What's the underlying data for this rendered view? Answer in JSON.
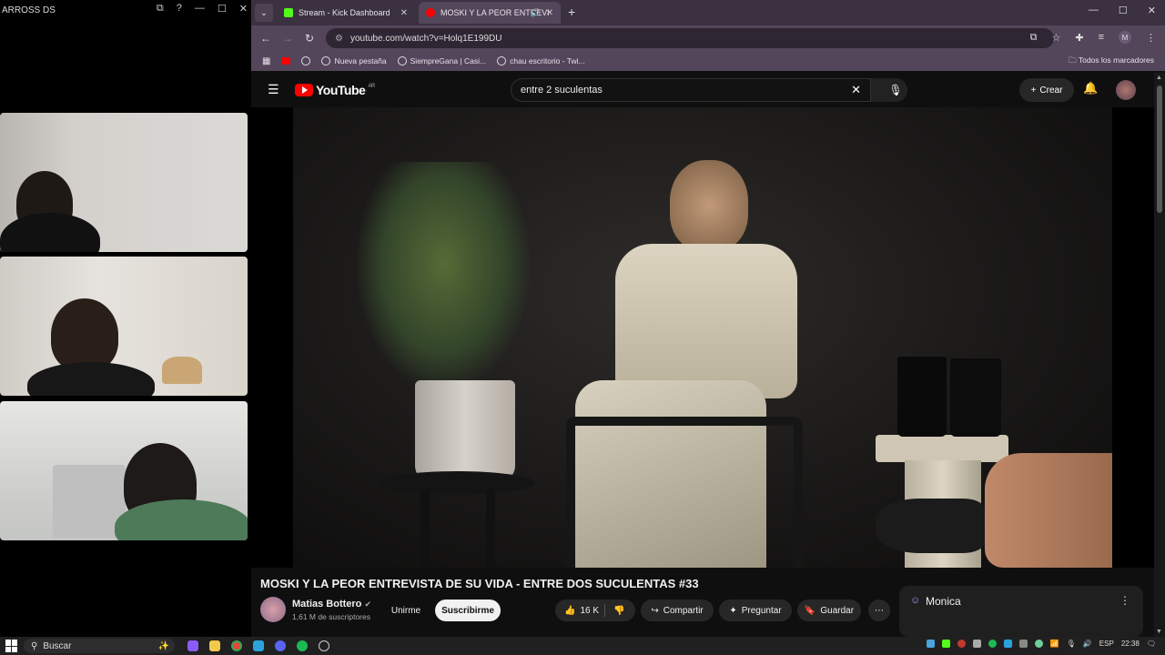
{
  "left_window": {
    "title": "ARROSS DS",
    "controls": [
      "⧉",
      "?",
      "—",
      "☐",
      "✕"
    ]
  },
  "browser": {
    "tabs": [
      {
        "label": "Stream - Kick Dashboard",
        "favicon_color": "#53fc18"
      },
      {
        "label": "MOSKI Y LA PEOR ENTREVI",
        "favicon_color": "#ff0000",
        "audio": "🔊"
      }
    ],
    "new_tab": "+",
    "window_controls": [
      "—",
      "☐",
      "✕"
    ],
    "url": "youtube.com/watch?v=Holq1E199DU",
    "profile_initial": "M",
    "bookmarks": [
      "Nueva pestaña",
      "SiempreGana | Casi...",
      "chau escritorio - Twi..."
    ],
    "bookmarks_all": "Todos los marcadores"
  },
  "youtube": {
    "logo_text": "YouTube",
    "region": "AR",
    "search_value": "entre 2 suculentas",
    "create_label": "Crear",
    "video_title": "MOSKI Y LA PEOR ENTREVISTA DE SU VIDA - ENTRE DOS SUCULENTAS #33",
    "channel_name": "Matias Bottero",
    "channel_subs": "1,61 M de suscriptores",
    "join_label": "Unirme",
    "subscribe_label": "Suscribirme",
    "likes": "16 K",
    "share_label": "Compartir",
    "ask_label": "Preguntar",
    "save_label": "Guardar",
    "monica_label": "Monica"
  },
  "taskbar": {
    "search_placeholder": "Buscar",
    "lang": "ESP",
    "time": "22:38"
  },
  "colors": {
    "accent_red": "#ff0000",
    "tab_bar": "#3b3141",
    "toolbar": "#53465a"
  }
}
